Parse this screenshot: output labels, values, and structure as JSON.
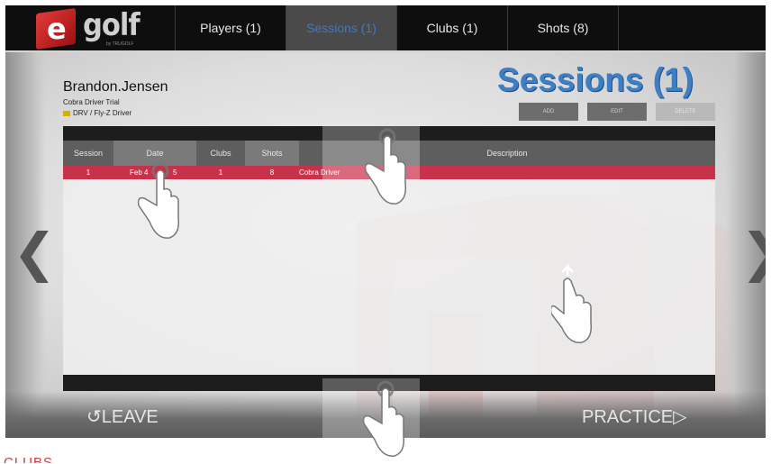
{
  "logo": {
    "letter": "e",
    "wordmark": "golf",
    "sub": "by TRUGOLF"
  },
  "tabs": [
    {
      "label": "Players (1)",
      "active": false
    },
    {
      "label": "Sessions (1)",
      "active": true
    },
    {
      "label": "Clubs (1)",
      "active": false
    },
    {
      "label": "Shots (8)",
      "active": false
    }
  ],
  "player": {
    "name": "Brandon.Jensen",
    "session": "Cobra Driver Trial",
    "club": "DRV / Fly-Z Driver",
    "club_color": "#d2b000"
  },
  "page_title": "Sessions (1)",
  "actions": {
    "add": "ADD",
    "edit": "EDIT",
    "delete": "DELETE"
  },
  "table": {
    "columns": [
      "Session",
      "Date",
      "Clubs",
      "Shots",
      "Description"
    ],
    "rows": [
      {
        "session": "1",
        "date": "Feb 4",
        "date_tail": "5",
        "clubs": "1",
        "shots": "8",
        "description": "Cobra Driver"
      }
    ]
  },
  "nav": {
    "left": "❮",
    "right": "❯"
  },
  "footer": {
    "leave": "LEAVE",
    "leave_icon": "↺",
    "practice": "PRACTICE",
    "practice_icon": "▷"
  },
  "caption": "CLUBS",
  "colors": {
    "accent": "#3d7fc4",
    "selected_row": "#c8314a",
    "brand_red": "#c62828"
  },
  "gestures": [
    "tap-hand-icon",
    "tap-hand-icon",
    "swipe-up-hand-icon",
    "tap-hand-icon"
  ]
}
